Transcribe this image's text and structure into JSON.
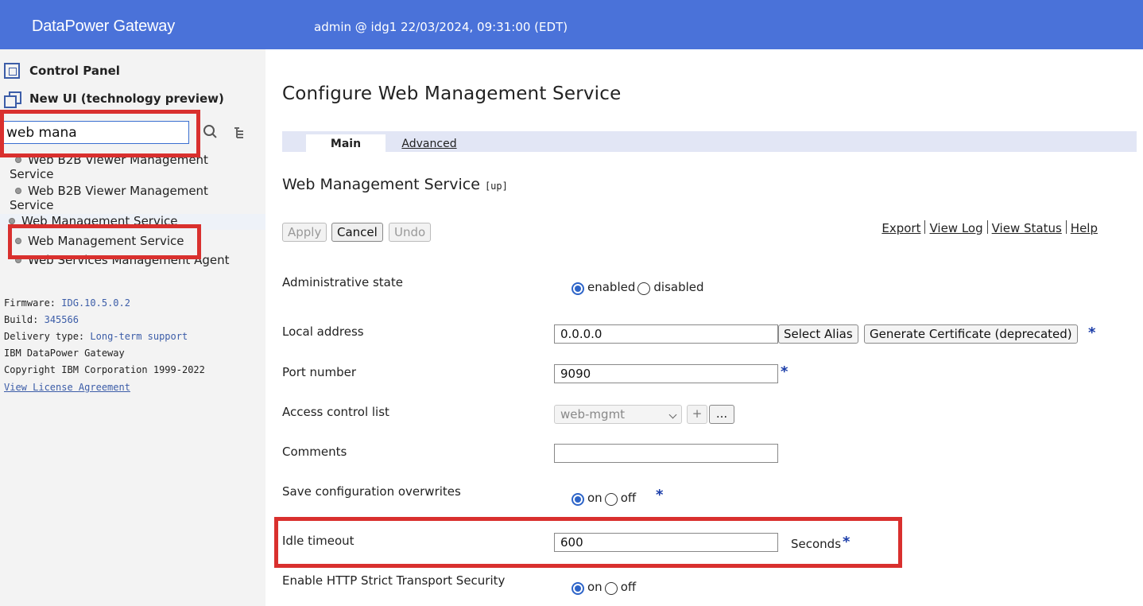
{
  "header": {
    "brand": "DataPower Gateway",
    "session": "admin @ idg1 22/03/2024, 09:31:00 (EDT)"
  },
  "sidebar": {
    "control_panel": "Control Panel",
    "new_ui": "New UI (technology preview)",
    "search_value": "web mana",
    "results": [
      {
        "line1": "Web B2B Viewer Management",
        "line2": "Service"
      },
      {
        "line1": "Web B2B Viewer Management",
        "line2": "Service"
      },
      {
        "line1": "Web Management Service"
      },
      {
        "line1": "Web Management Service"
      },
      {
        "line1": "Web Services Management Agent"
      }
    ],
    "firmware_label": "Firmware:",
    "firmware_value": "IDG.10.5.0.2",
    "build_label": "Build:",
    "build_value": "345566",
    "delivery_label": "Delivery type:",
    "delivery_value": "Long-term support",
    "product": "IBM DataPower Gateway",
    "copyright": "Copyright IBM Corporation 1999-2022",
    "license_link": "View License Agreement"
  },
  "main": {
    "title": "Configure Web Management Service",
    "tabs": [
      {
        "label": "Main",
        "active": true
      },
      {
        "label": "Advanced",
        "active": false
      }
    ],
    "object_title": "Web Management Service",
    "object_status": "[up]",
    "buttons": {
      "apply": "Apply",
      "cancel": "Cancel",
      "undo": "Undo"
    },
    "links": {
      "export": "Export",
      "view_log": "View Log",
      "view_status": "View Status",
      "help": "Help"
    },
    "fields": {
      "admin_state": {
        "label": "Administrative state",
        "option_on": "enabled",
        "option_off": "disabled",
        "selected": "enabled"
      },
      "local_address": {
        "label": "Local address",
        "value": "0.0.0.0",
        "select_alias": "Select Alias",
        "gen_cert": "Generate Certificate (deprecated)"
      },
      "port": {
        "label": "Port number",
        "value": "9090"
      },
      "acl": {
        "label": "Access control list",
        "value": "web-mgmt",
        "add": "+",
        "more": "..."
      },
      "comments": {
        "label": "Comments",
        "value": ""
      },
      "save_overwrites": {
        "label": "Save configuration overwrites",
        "option_on": "on",
        "option_off": "off",
        "selected": "on"
      },
      "idle_timeout": {
        "label": "Idle timeout",
        "value": "600",
        "unit": "Seconds"
      },
      "hsts": {
        "label": "Enable HTTP Strict Transport Security",
        "option_on": "on",
        "option_off": "off",
        "selected": "on"
      }
    },
    "required_mark": "*"
  },
  "colors": {
    "header_bg": "#4a72d9",
    "highlight_box": "#d9302e",
    "link_blue": "#3c5da8"
  }
}
